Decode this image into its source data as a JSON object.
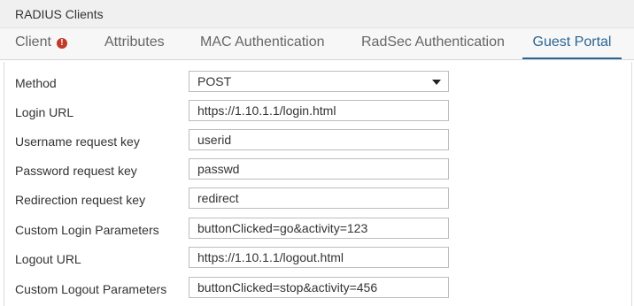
{
  "window": {
    "title": "RADIUS Clients"
  },
  "tabs": [
    {
      "label": "Client",
      "has_alert": true,
      "alert_symbol": "!"
    },
    {
      "label": "Attributes"
    },
    {
      "label": "MAC Authentication"
    },
    {
      "label": "RadSec Authentication"
    },
    {
      "label": "Guest Portal",
      "active": true
    }
  ],
  "form": {
    "method": {
      "label": "Method",
      "value": "POST"
    },
    "login_url": {
      "label": "Login URL",
      "value": "https://1.10.1.1/login.html"
    },
    "username_key": {
      "label": "Username request key",
      "value": "userid"
    },
    "password_key": {
      "label": "Password request key",
      "value": "passwd"
    },
    "redirection_key": {
      "label": "Redirection request key",
      "value": "redirect"
    },
    "custom_login_params": {
      "label": "Custom Login Parameters",
      "value": "buttonClicked=go&activity=123"
    },
    "logout_url": {
      "label": "Logout URL",
      "value": "https://1.10.1.1/logout.html"
    },
    "custom_logout_params": {
      "label": "Custom Logout Parameters",
      "value": "buttonClicked=stop&activity=456"
    }
  },
  "colors": {
    "accent": "#2a6596",
    "alert": "#c0392b",
    "tab_bar_bg": "#f7f7f7",
    "title_bar_bg": "#f0f0f0"
  },
  "icons": {
    "alert": "alert-circle-icon",
    "dropdown": "caret-down-icon"
  }
}
